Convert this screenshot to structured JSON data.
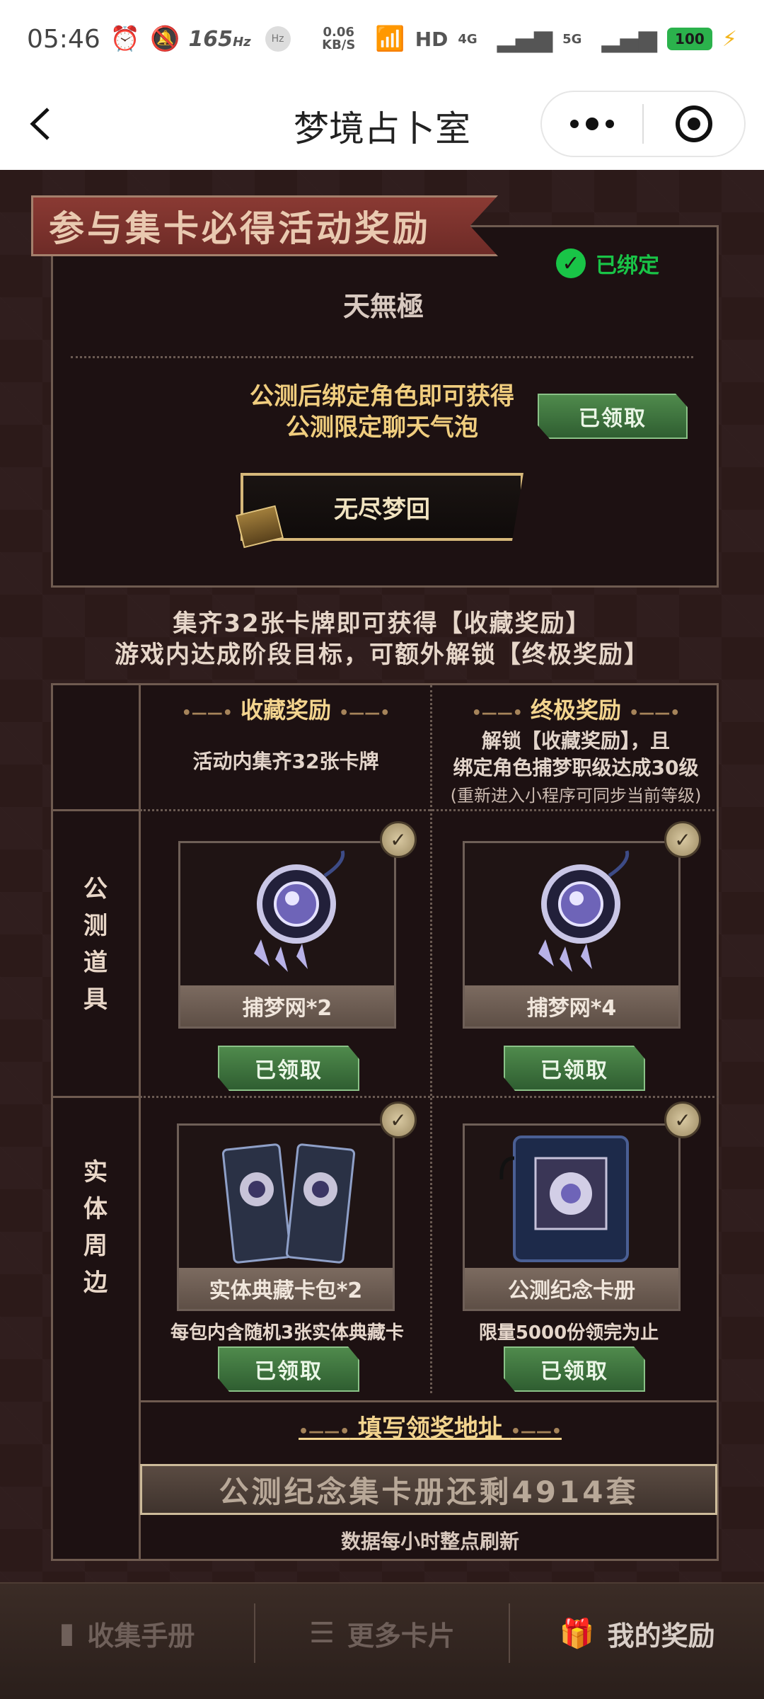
{
  "status_bar": {
    "time": "05:46",
    "refresh_rate": "165",
    "refresh_unit": "Hz",
    "hz_badge": "Hz",
    "speed_value": "0.06",
    "speed_unit": "KB/S",
    "hd_label": "HD",
    "net1": "4G",
    "net2": "5G",
    "battery": "100",
    "icons": [
      "alarm-icon",
      "mute-icon",
      "wifi-icon",
      "signal-icon",
      "charging-icon"
    ]
  },
  "nav": {
    "title": "梦境占卜室",
    "icons": [
      "back-icon",
      "more-icon",
      "miniprogram-close-icon"
    ]
  },
  "participate": {
    "banner": "参与集卡必得活动奖励",
    "bound_label": "已绑定",
    "character_name": "天無極",
    "bind_line1": "公测后绑定角色即可获得",
    "bind_line2": "公测限定聊天气泡",
    "claimed_label": "已领取",
    "bubble_text": "无尽梦回"
  },
  "info": {
    "line1": "集齐32张卡牌即可获得【收藏奖励】",
    "line2": "游戏内达成阶段目标，可额外解锁【终极奖励】"
  },
  "rewards": {
    "collect": {
      "title": "收藏奖励",
      "desc": "活动内集齐32张卡牌"
    },
    "ultimate": {
      "title": "终极奖励",
      "desc_line1": "解锁【收藏奖励】，且",
      "desc_line2": "绑定角色捕梦职级达成30级",
      "note": "(重新进入小程序可同步当前等级)"
    },
    "row_game_label": [
      "公",
      "测",
      "道",
      "具"
    ],
    "row_physical_label": [
      "实",
      "体",
      "周",
      "边"
    ],
    "items": [
      {
        "name": "捕梦网*2",
        "status": "已领取",
        "icon": "dreamcatcher-icon"
      },
      {
        "name": "捕梦网*4",
        "status": "已领取",
        "icon": "dreamcatcher-icon"
      },
      {
        "name": "实体典藏卡包*2",
        "status": "已领取",
        "desc": "每包内含随机3张实体典藏卡",
        "icon": "card-pack-icon"
      },
      {
        "name": "公测纪念卡册",
        "status": "已领取",
        "desc": "限量5000份领完为止",
        "icon": "card-album-icon"
      }
    ],
    "address_link": "填写领奖地址",
    "remaining": "公测纪念集卡册还剩4914套",
    "refresh_note": "数据每小时整点刷新"
  },
  "tabs": [
    {
      "label": "收集手册",
      "icon": "book-icon",
      "active": false
    },
    {
      "label": "更多卡片",
      "icon": "list-icon",
      "active": false
    },
    {
      "label": "我的奖励",
      "icon": "gift-icon",
      "active": true
    }
  ],
  "colors": {
    "background": "#2c1a19",
    "gold": "#f0cd7e",
    "green": "#19c447",
    "button_green": "#4f8a4c"
  }
}
